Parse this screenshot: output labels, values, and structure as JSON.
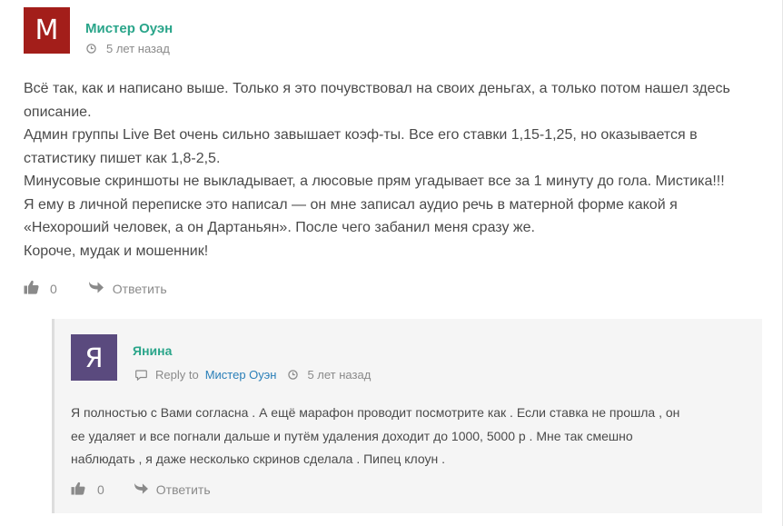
{
  "comments": [
    {
      "avatar_letter": "М",
      "avatar_color": "#a31e1a",
      "author": "Мистер Оуэн",
      "time": "5 лет назад",
      "lines": [
        "Всё так, как и написано выше. Только я это почувствовал на своих деньгах, а только потом нашел здесь",
        "описание.",
        "Админ группы Live Bet очень сильно завышает коэф-ты. Все его ставки 1,15-1,25, но оказывается в",
        "статистику пишет как 1,8-2,5.",
        "Минусовые скриншоты не выкладывает, а люсовые прям угадывает все за 1 минуту до гола. Мистика!!!",
        "Я ему в личной переписке это написал — он мне записал аудио речь в матерной форме какой я",
        "«Нехороший человек, а он Дартаньян». После чего забанил меня сразу же.",
        "Короче, мудак и мошенник!"
      ],
      "likes": "0",
      "reply_label": "Ответить",
      "like_icon": "thumbs-up-icon",
      "reply_icon": "reply-arrow-icon"
    },
    {
      "avatar_letter": "Я",
      "avatar_color": "#5a4a7e",
      "author": "Янина",
      "reply_to_label": "Reply to",
      "reply_to_name": "Мистер Оуэн",
      "time": "5 лет назад",
      "lines": [
        "Я полностью с Вами согласна . А ещё марафон проводит посмотрите как . Если ставка не прошла , он",
        "ее удаляет и все погнали дальше и путём удаления доходит до 1000, 5000 р . Мне так смешно",
        "наблюдать , я даже несколько скринов сделала . Пипец клоун ."
      ],
      "likes": "0",
      "reply_label": "Ответить"
    }
  ],
  "colors": {
    "author": "#2aa58a",
    "link": "#2a7fb8",
    "meta": "#8a8a8a",
    "text": "#4a4a4a",
    "reply_bg": "#f5f5f5"
  }
}
